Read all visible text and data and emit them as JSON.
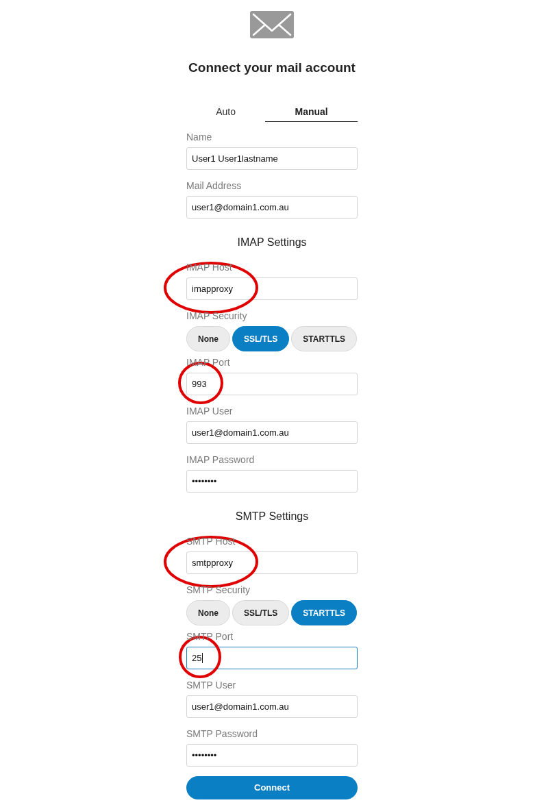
{
  "header": {
    "title": "Connect your mail account"
  },
  "tabs": [
    {
      "label": "Auto",
      "selected": false
    },
    {
      "label": "Manual",
      "selected": true
    }
  ],
  "account_fields": [
    {
      "kind": "text",
      "label": "Name",
      "value": "User1 User1lastname",
      "focused": false,
      "annotated": false
    },
    {
      "kind": "text",
      "label": "Mail Address",
      "value": "user1@domain1.com.au",
      "focused": false,
      "annotated": false
    }
  ],
  "sections": [
    {
      "heading": "IMAP Settings",
      "fields": [
        {
          "kind": "text",
          "label": "IMAP Host",
          "value": "imapproxy",
          "focused": false,
          "annotated": true
        },
        {
          "kind": "choice",
          "label": "IMAP Security",
          "options": [
            {
              "label": "None",
              "selected": false
            },
            {
              "label": "SSL/TLS",
              "selected": true
            },
            {
              "label": "STARTTLS",
              "selected": false
            }
          ]
        },
        {
          "kind": "text",
          "label": "IMAP Port",
          "value": "993",
          "focused": false,
          "annotated": true
        },
        {
          "kind": "text",
          "label": "IMAP User",
          "value": "user1@domain1.com.au",
          "focused": false,
          "annotated": false
        },
        {
          "kind": "text",
          "label": "IMAP Password",
          "value": "••••••••",
          "focused": false,
          "annotated": false
        }
      ]
    },
    {
      "heading": "SMTP Settings",
      "fields": [
        {
          "kind": "text",
          "label": "SMTP Host",
          "value": "smtpproxy",
          "focused": false,
          "annotated": true
        },
        {
          "kind": "choice",
          "label": "SMTP Security",
          "options": [
            {
              "label": "None",
              "selected": false
            },
            {
              "label": "SSL/TLS",
              "selected": false
            },
            {
              "label": "STARTTLS",
              "selected": true
            }
          ]
        },
        {
          "kind": "text",
          "label": "SMTP Port",
          "value": "25",
          "focused": true,
          "annotated": true
        },
        {
          "kind": "text",
          "label": "SMTP User",
          "value": "user1@domain1.com.au",
          "focused": false,
          "annotated": false
        },
        {
          "kind": "text",
          "label": "SMTP Password",
          "value": "••••••••",
          "focused": false,
          "annotated": false
        }
      ]
    }
  ],
  "connect_button": {
    "label": "Connect"
  }
}
